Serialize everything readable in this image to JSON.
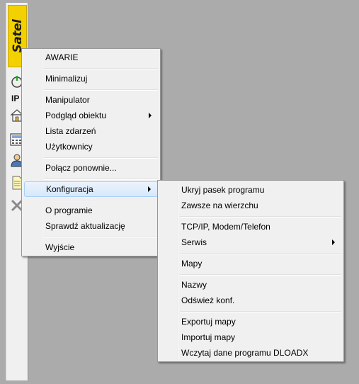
{
  "toolbar": {
    "logo_text": "Satel",
    "status_label": "IP",
    "icons": [
      "power-icon",
      "house-icon",
      "keypad-icon",
      "user-icon",
      "document-icon",
      "close-icon"
    ]
  },
  "main_menu": {
    "items": [
      {
        "label": "AWARIE"
      },
      {
        "label": "Minimalizuj"
      },
      {
        "label": "Manipulator"
      },
      {
        "label": "Podgląd obiektu",
        "submenu": true
      },
      {
        "label": "Lista zdarzeń"
      },
      {
        "label": "Użytkownicy"
      },
      {
        "label": "Połącz ponownie..."
      },
      {
        "label": "Konfiguracja",
        "submenu": true,
        "active": true
      },
      {
        "label": "O programie"
      },
      {
        "label": "Sprawdź aktualizację"
      },
      {
        "label": "Wyjście"
      }
    ]
  },
  "config_menu": {
    "items": [
      {
        "label": "Ukryj pasek programu"
      },
      {
        "label": "Zawsze na wierzchu"
      },
      {
        "label": "TCP/IP, Modem/Telefon"
      },
      {
        "label": "Serwis",
        "submenu": true
      },
      {
        "label": "Mapy"
      },
      {
        "label": "Nazwy"
      },
      {
        "label": "Odśwież konf."
      },
      {
        "label": "Exportuj mapy"
      },
      {
        "label": "Importuj mapy"
      },
      {
        "label": "Wczytaj dane programu DLOADX"
      }
    ]
  },
  "colors": {
    "background": "#ababab",
    "menu_bg": "#f0f0f0",
    "logo_yellow": "#f3d100",
    "highlight_border": "#a8d0f7",
    "power_green": "#2fa82f"
  }
}
